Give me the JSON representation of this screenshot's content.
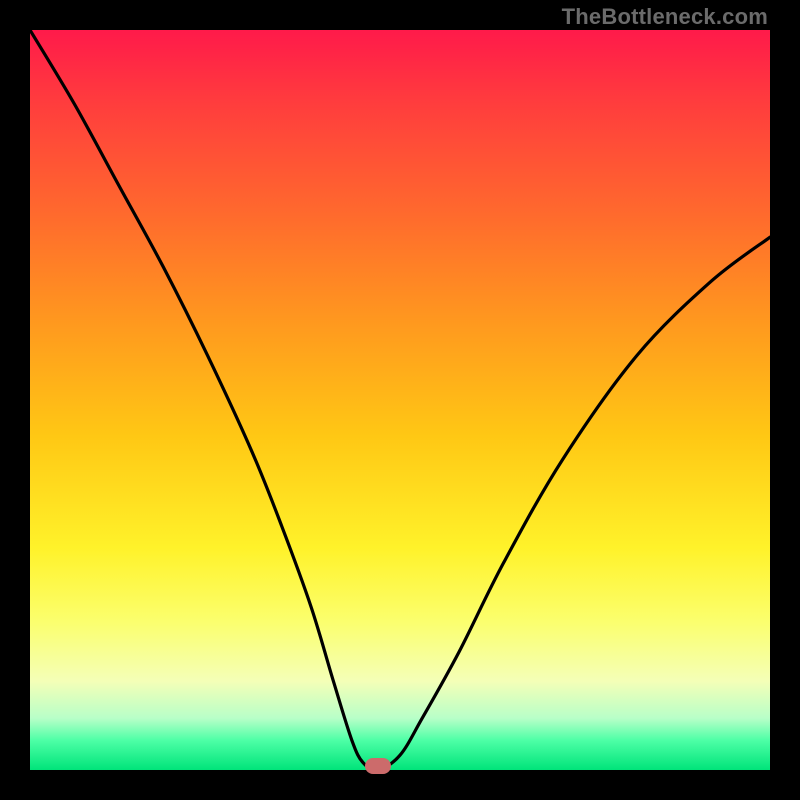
{
  "watermark": "TheBottleneck.com",
  "chart_data": {
    "type": "line",
    "title": "",
    "xlabel": "",
    "ylabel": "",
    "xlim": [
      0,
      100
    ],
    "ylim": [
      0,
      100
    ],
    "series": [
      {
        "name": "curve",
        "x": [
          0,
          6,
          12,
          18,
          24,
          30,
          34,
          38,
          41,
          43.5,
          45,
          47,
          50,
          53,
          58,
          64,
          72,
          82,
          92,
          100
        ],
        "values": [
          100,
          90,
          79,
          68,
          56,
          43,
          33,
          22,
          12,
          4,
          1,
          0,
          2,
          7,
          16,
          28,
          42,
          56,
          66,
          72
        ]
      }
    ],
    "marker": {
      "x": 47,
      "y": 0.5,
      "color": "#cc6b6b"
    },
    "gradient_stops": [
      {
        "offset": 0,
        "color": "#ff1a4a"
      },
      {
        "offset": 25,
        "color": "#ff6a2d"
      },
      {
        "offset": 55,
        "color": "#ffc814"
      },
      {
        "offset": 80,
        "color": "#fbff6e"
      },
      {
        "offset": 100,
        "color": "#00e47a"
      }
    ]
  }
}
